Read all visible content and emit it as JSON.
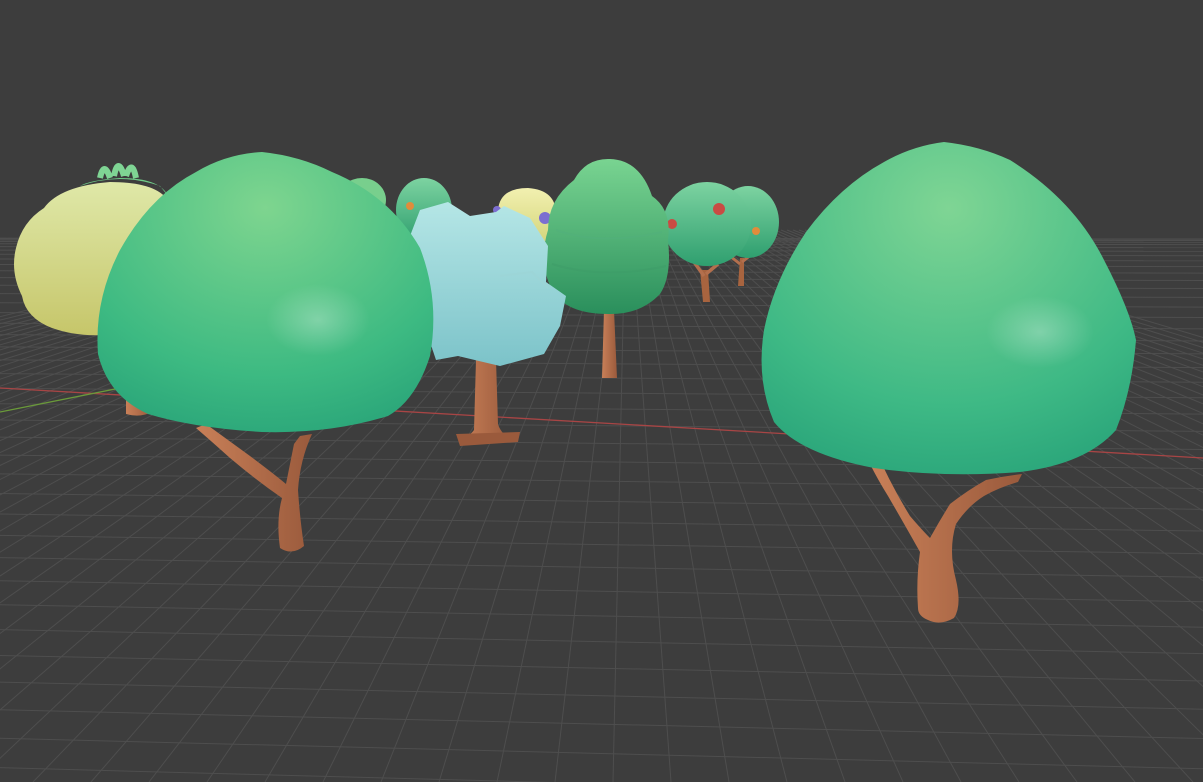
{
  "viewport": {
    "mode_label": "",
    "background_color": "#3d3d3d",
    "grid_color": "#4e4e4e",
    "x_axis_color": "#a84545",
    "y_axis_color": "#6a9a3a"
  },
  "scene": {
    "objects": [
      {
        "name": "tree-bush-yellow",
        "kind": "bush",
        "colors": {
          "top": "#c7d9a0",
          "bottom": "#c6c66a"
        }
      },
      {
        "name": "tree-round-large-left",
        "kind": "round-canopy",
        "colors": {
          "top": "#7ed58f",
          "bottom": "#2aa579"
        }
      },
      {
        "name": "tree-small-back-1",
        "kind": "round-canopy",
        "colors": {
          "top": "#7dd3a1",
          "bottom": "#3aa87a"
        }
      },
      {
        "name": "tree-blocky-cyan",
        "kind": "blocky-canopy",
        "colors": {
          "top": "#aee3e3",
          "bottom": "#7cc3c9"
        }
      },
      {
        "name": "tree-yellow-berries",
        "kind": "bush",
        "colors": {
          "top": "#f2f0b0",
          "bottom": "#d3d57a"
        }
      },
      {
        "name": "tree-tall-pine",
        "kind": "layered-canopy",
        "colors": {
          "top": "#76d28e",
          "bottom": "#2a8f5c"
        }
      },
      {
        "name": "tree-fruit-right",
        "kind": "round-canopy",
        "colors": {
          "top": "#7bd39a",
          "bottom": "#2f9f6f"
        }
      },
      {
        "name": "tree-round-large-right",
        "kind": "round-canopy",
        "colors": {
          "top": "#7fd594",
          "bottom": "#2aa57a"
        }
      }
    ],
    "trunk_color": "#b36f4d",
    "trunk_shadow_color": "#8a4f35",
    "fruit_colors": [
      "#c94b43",
      "#7c6ed1",
      "#e08c3b"
    ]
  }
}
